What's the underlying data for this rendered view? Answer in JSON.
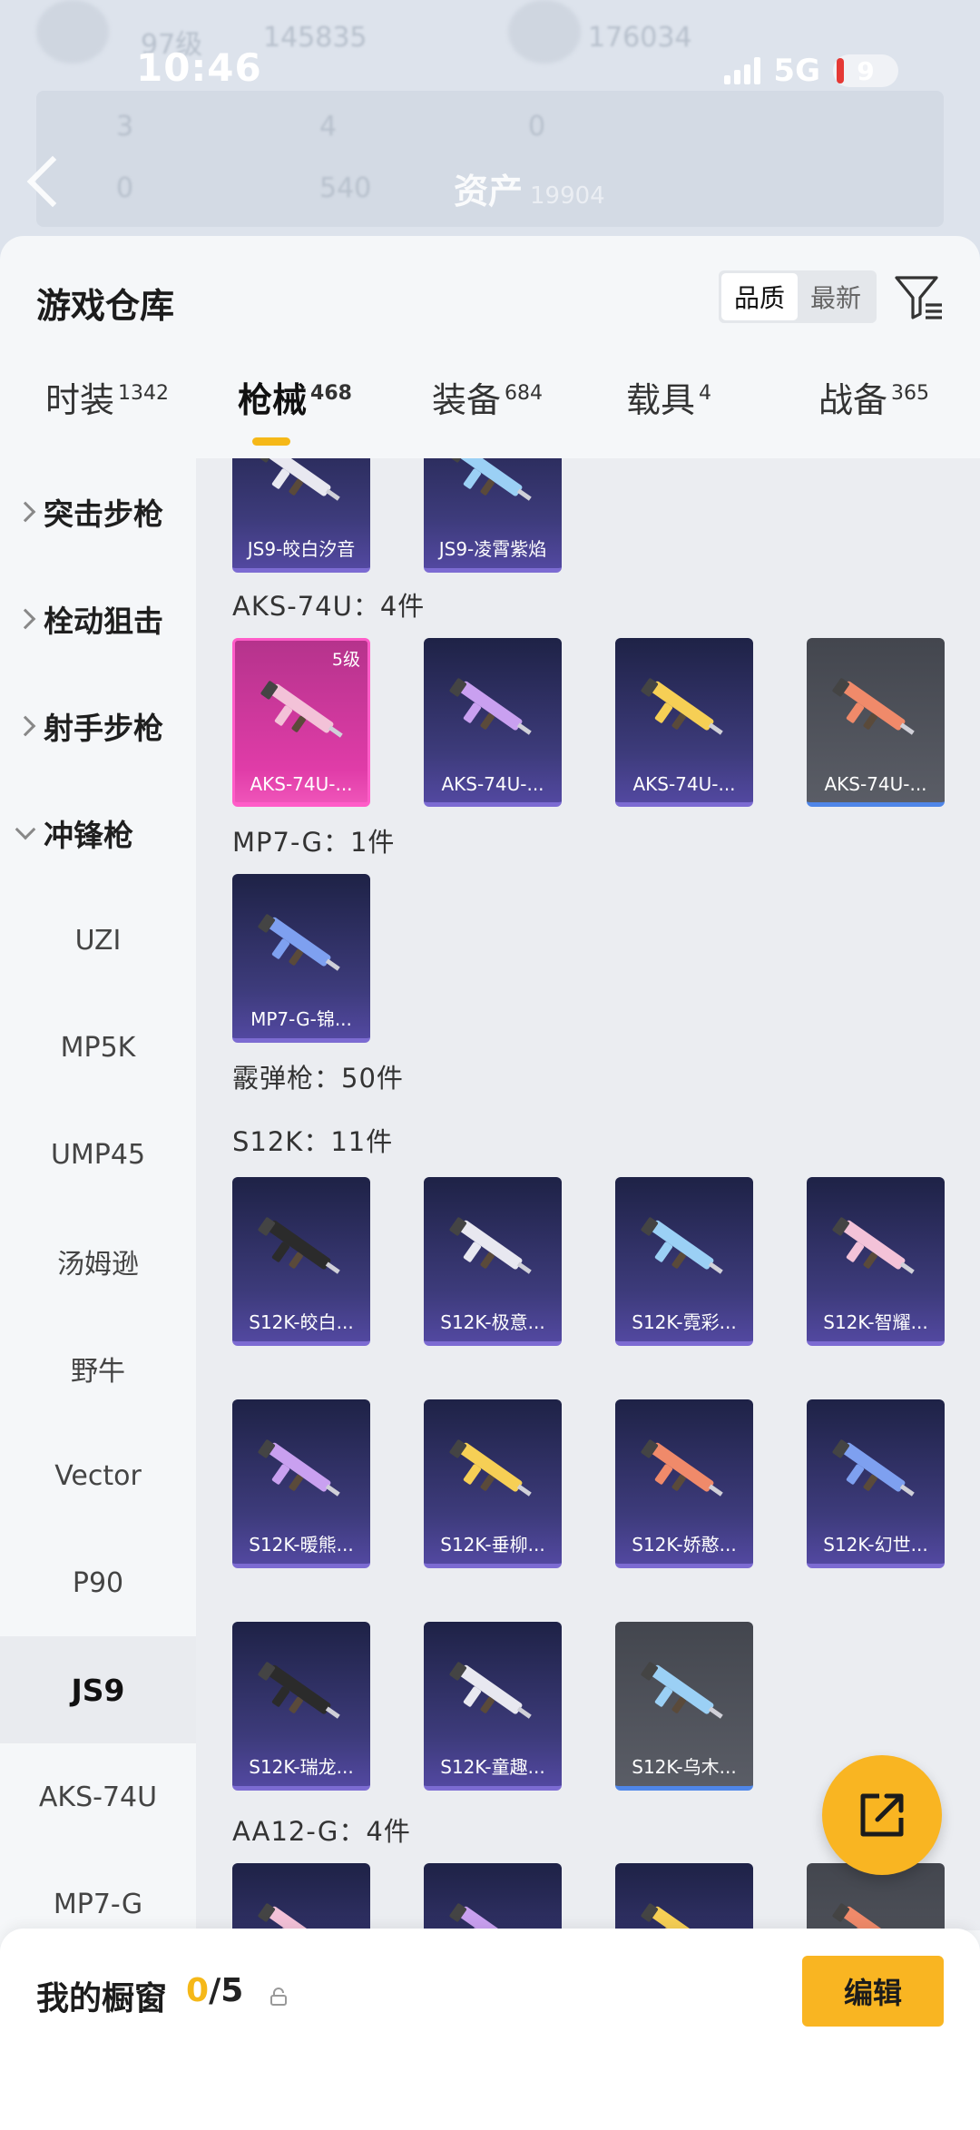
{
  "status_bar": {
    "time": "10:46",
    "network": "5G",
    "battery": "9"
  },
  "background_header": {
    "level": "97级",
    "points1": "145835",
    "points2": "176034",
    "stats_row1": [
      "3",
      "4",
      "0"
    ],
    "stats_row2": [
      "0",
      "540"
    ],
    "asset_label": "资产",
    "asset_value": "19904"
  },
  "sheet": {
    "title": "游戏仓库",
    "sort_options": [
      "品质",
      "最新"
    ],
    "tabs": [
      {
        "label": "时装",
        "count": "1342"
      },
      {
        "label": "枪械",
        "count": "468"
      },
      {
        "label": "装备",
        "count": "684"
      },
      {
        "label": "载具",
        "count": "4"
      },
      {
        "label": "战备",
        "count": "365"
      }
    ]
  },
  "sidebar": {
    "categories": [
      "突击步枪",
      "栓动狙击",
      "射手步枪",
      "冲锋枪"
    ],
    "subcategories": [
      "UZI",
      "MP5K",
      "UMP45",
      "汤姆逊",
      "野牛",
      "Vector",
      "P90",
      "JS9",
      "AKS-74U",
      "MP7-G"
    ]
  },
  "content": {
    "js9_items": [
      "JS9-皎白汐音",
      "JS9-凌霄紫焰"
    ],
    "aks_title": "AKS-74U：4件",
    "aks_items": [
      "AKS-74U-...",
      "AKS-74U-...",
      "AKS-74U-...",
      "AKS-74U-..."
    ],
    "aks_level": "5级",
    "mp7_title": "MP7-G：1件",
    "mp7_items": [
      "MP7-G-锦..."
    ],
    "shotgun_title": "霰弹枪：50件",
    "s12k_title": "S12K：11件",
    "s12k_items": [
      "S12K-皎白...",
      "S12K-极意...",
      "S12K-霓彩...",
      "S12K-智耀...",
      "S12K-暖熊...",
      "S12K-垂柳...",
      "S12K-娇憨...",
      "S12K-幻世...",
      "S12K-瑞龙...",
      "S12K-童趣...",
      "S12K-乌木..."
    ],
    "aa12_title": "AA12-G：4件"
  },
  "bottom": {
    "showcase_label": "我的橱窗",
    "showcase_current": "0",
    "showcase_total": "/5",
    "edit_label": "编辑"
  },
  "colors": {
    "accent": "#f9b522",
    "card_purple": "#3d3b7b",
    "card_pink": "#e03ca8",
    "card_gray": "#5a5d66"
  }
}
